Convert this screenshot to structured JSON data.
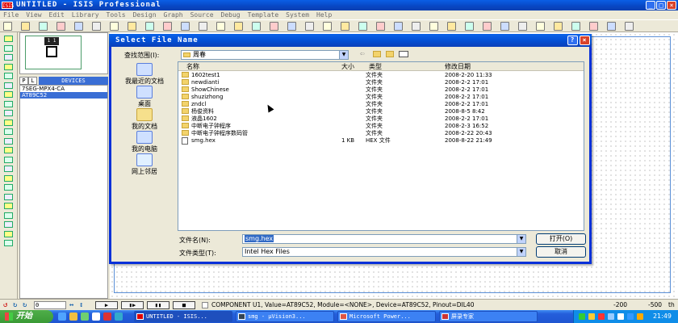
{
  "window": {
    "app_icon": "ISIS",
    "title": "UNTITLED - ISIS Professional",
    "buttons": [
      "_",
      "□",
      "×"
    ]
  },
  "menu": [
    "File",
    "View",
    "Edit",
    "Library",
    "Tools",
    "Design",
    "Graph",
    "Source",
    "Debug",
    "Template",
    "System",
    "Help"
  ],
  "toolbar_icons": [
    "new-icon",
    "open-icon",
    "save-icon",
    "import-icon",
    "export-icon",
    "print-icon",
    "area-icon",
    "redraw-icon",
    "grid-icon",
    "origin-icon",
    "pan-icon",
    "zoom-in-icon",
    "zoom-out-icon",
    "zoom-all-icon",
    "zoom-area-icon",
    "undo-icon",
    "redo-icon",
    "cut-icon",
    "copy-icon",
    "paste-icon",
    "block-copy-icon",
    "block-move-icon",
    "block-rotate-icon",
    "block-delete-icon",
    "pick-device-icon",
    "make-device-icon",
    "packaging-icon",
    "decompose-icon",
    "wire-autorouter-icon",
    "search-tag-icon",
    "property-tool-icon",
    "new-sheet-icon",
    "remove-sheet-icon",
    "zoom-sheet-icon",
    "netlist-icon",
    "ares-icon"
  ],
  "overview": {
    "chip_label": "1 1 1"
  },
  "device_panel": {
    "p_button": "P",
    "l_button": "L",
    "header": "DEVICES",
    "items": [
      "7SEG-MPX4-CA",
      "AT89C52"
    ],
    "selected_index": 1
  },
  "dialog": {
    "title": "Select File Name",
    "lookin_label": "查找范围(I):",
    "lookin_value": "周春",
    "places": [
      "我最近的文档",
      "桌面",
      "我的文档",
      "我的电脑",
      "网上邻居"
    ],
    "columns": {
      "name": "名称",
      "size": "大小",
      "type": "类型",
      "modified": "修改日期"
    },
    "files": [
      {
        "name": "1602test1",
        "size": "",
        "type": "文件夹",
        "modified": "2008-2-20 11:33",
        "kind": "folder"
      },
      {
        "name": "newdianti",
        "size": "",
        "type": "文件夹",
        "modified": "2008-2-2 17:01",
        "kind": "folder"
      },
      {
        "name": "ShowChinese",
        "size": "",
        "type": "文件夹",
        "modified": "2008-2-2 17:01",
        "kind": "folder"
      },
      {
        "name": "shuzizhong",
        "size": "",
        "type": "文件夹",
        "modified": "2008-2-2 17:01",
        "kind": "folder"
      },
      {
        "name": "zndcl",
        "size": "",
        "type": "文件夹",
        "modified": "2008-2-2 17:01",
        "kind": "folder"
      },
      {
        "name": "杨俊资料",
        "size": "",
        "type": "文件夹",
        "modified": "2008-8-5 8:42",
        "kind": "folder"
      },
      {
        "name": "液晶1602",
        "size": "",
        "type": "文件夹",
        "modified": "2008-2-2 17:01",
        "kind": "folder"
      },
      {
        "name": "中断电子钟程序",
        "size": "",
        "type": "文件夹",
        "modified": "2008-2-3 16:52",
        "kind": "folder"
      },
      {
        "name": "中断电子钟程序数码管",
        "size": "",
        "type": "文件夹",
        "modified": "2008-2-22 20:43",
        "kind": "folder"
      },
      {
        "name": "smg.hex",
        "size": "1 KB",
        "type": "HEX 文件",
        "modified": "2008-8-22 21:49",
        "kind": "file"
      }
    ],
    "filename_label": "文件名(N):",
    "filename_value": "smg.hex",
    "filetype_label": "文件类型(T):",
    "filetype_value": "Intel Hex Files",
    "open_button": "打开(O)",
    "cancel_button": "取消"
  },
  "statusbar": {
    "rotation_value": "0",
    "play_buttons": [
      "▶",
      "▮▶",
      "▮▮",
      "■"
    ],
    "message": "COMPONENT U1, Value=AT89C52, Module=<NONE>, Device=AT89C52, Pinout=DIL40",
    "coord_x": "-200",
    "coord_y": "-500",
    "unit": "th"
  },
  "taskbar": {
    "start": "开始",
    "tasks": [
      "UNTITLED - ISIS...",
      "smg - μVision3...",
      "Microsoft Power...",
      "屏录专家"
    ],
    "clock": "21:49"
  }
}
